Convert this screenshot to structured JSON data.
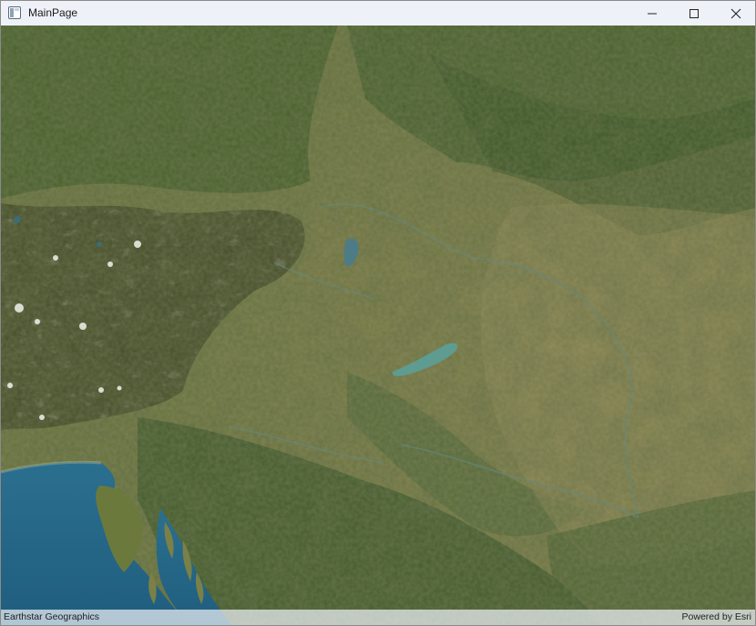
{
  "window": {
    "title": "MainPage"
  },
  "map": {
    "basemap": "satellite imagery",
    "attribution": "Earthstar Geographics",
    "powered_by": "Powered by Esri"
  },
  "icons": {
    "app": "app-window-icon",
    "minimize": "minimize-icon",
    "maximize": "maximize-icon",
    "close": "close-icon"
  }
}
